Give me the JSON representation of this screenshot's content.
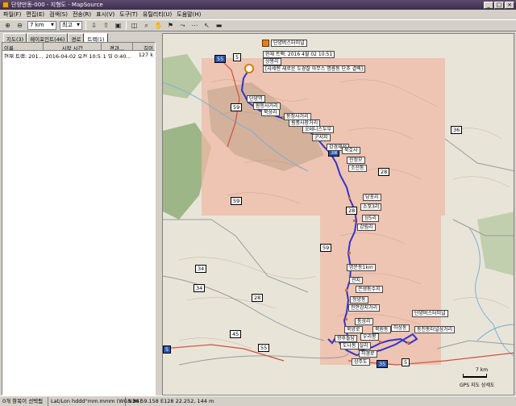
{
  "window": {
    "title": "단양만동-000 - 지형도 - MapSource",
    "minimize": "_",
    "maximize": "□",
    "close": "×"
  },
  "menu": [
    "파일(F)",
    "편집(E)",
    "검색(S)",
    "전송(R)",
    "표시(V)",
    "도구(T)",
    "유틸리티(U)",
    "도움말(H)"
  ],
  "toolbar": {
    "scale_value": "7 km",
    "detail_value": "최고"
  },
  "left_panel": {
    "tabs": [
      "지도(3)",
      "웨이포인트(46)",
      "경로",
      "트랙(1)"
    ],
    "active_tab": 3,
    "columns": [
      "이름",
      "시작 시간",
      "경과...",
      "길이"
    ],
    "rows": [
      [
        "현재 트랙: 201...",
        "2016-04-02 오전 10:51...",
        "1 일 0:40...",
        "127 k"
      ]
    ]
  },
  "map": {
    "callout_title": "단양버스터미널",
    "callout_track": "현재 트랙: 2016 4월 02 10:51",
    "callout_place": "상봉리",
    "callout_note": "[샤세렌 새로운 도경찰 아무스 명룡동 단추 결렉]",
    "road_shields": [
      "55",
      "5",
      "59",
      "36",
      "38",
      "28",
      "28",
      "59",
      "59",
      "34",
      "34",
      "28",
      "45",
      "55",
      "5",
      "35",
      "5"
    ],
    "place_labels": [
      "단양역",
      "원동사거리",
      "북상리",
      "동정사거리",
      "횡풍사장거리",
      "오테니스두부",
      "군서지",
      "강경재성",
      "북호사",
      "진정모",
      "소선동",
      "당포리",
      "소포3리",
      "상5리",
      "강림리",
      "명문동1km",
      "관지",
      "은생동수지",
      "청양동",
      "진안강지거리",
      "단양버스터미널",
      "통상리",
      "북양로",
      "향후돌담",
      "우리봉",
      "가실리",
      "북원동",
      "하상동",
      "도나동",
      "동진동터널삼거리",
      "하경로",
      "상주도"
    ],
    "scale_label": "7 km",
    "map_source": "GPS 지도 상세도"
  },
  "status": {
    "selection": "0개 항목이 선택됨",
    "format": "Lat/Lon hddd°mm.mmm (WGS 84)",
    "coords": "N36 59.158 E128 22.252, 144 m"
  },
  "colors": {
    "track": "#3333cc",
    "shaded_area": "#f0b8a8",
    "forest": "#8faa7a",
    "titlebar": "#4d3d5e"
  }
}
